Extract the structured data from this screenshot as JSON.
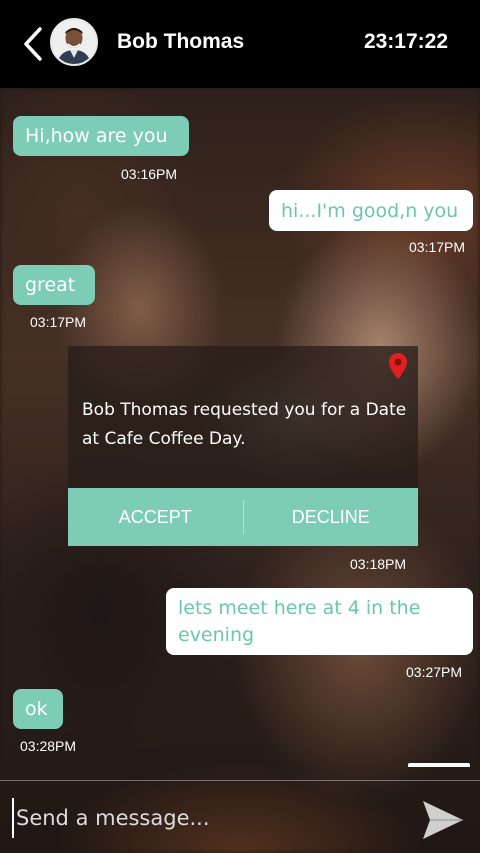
{
  "header": {
    "contact_name": "Bob Thomas",
    "clock": "23:17:22",
    "back_icon": "chevron-left-icon",
    "avatar": "contact-avatar"
  },
  "messages": [
    {
      "direction": "incoming",
      "text": "Hi,how are you",
      "time": "03:16PM"
    },
    {
      "direction": "outgoing",
      "text": "hi...I'm good,n you",
      "time": "03:17PM"
    },
    {
      "direction": "incoming",
      "text": "great",
      "time": "03:17PM"
    },
    {
      "direction": "outgoing",
      "text": "lets meet here at 4 in the evening",
      "time": "03:27PM"
    },
    {
      "direction": "incoming",
      "text": "ok",
      "time": "03:28PM"
    }
  ],
  "date_request": {
    "text": "Bob Thomas requested you for a Date at Cafe Coffee Day.",
    "accept_label": "ACCEPT",
    "decline_label": "DECLINE",
    "time": "03:18PM",
    "icon": "location-pin-icon"
  },
  "composer": {
    "placeholder": "Send a message...",
    "value": "",
    "send_icon": "send-icon"
  },
  "colors": {
    "accent": "#7dccb6",
    "outgoing_text": "#6cc6ad",
    "header_bg": "#000000",
    "pin": "#e02020"
  }
}
